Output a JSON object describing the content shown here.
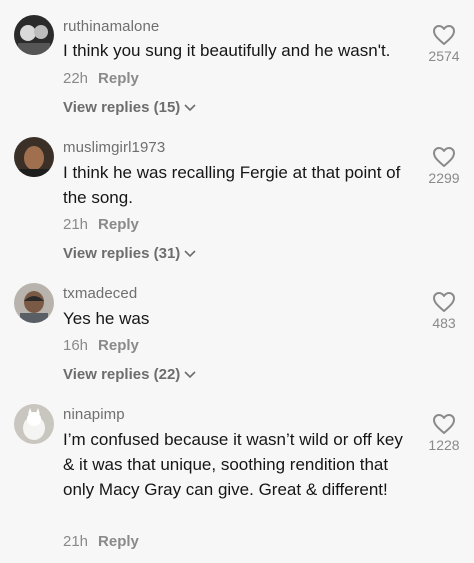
{
  "comments": [
    {
      "username": "ruthinamalone",
      "text": "I think you sung it beautifully and he wasn't.",
      "time": "22h",
      "reply_label": "Reply",
      "view_replies": "View replies (15)",
      "likes": "2574"
    },
    {
      "username": "muslimgirl1973",
      "text": "I think he was recalling Fergie at that point of the song.",
      "time": "21h",
      "reply_label": "Reply",
      "view_replies": "View replies (31)",
      "likes": "2299"
    },
    {
      "username": "txmadeced",
      "text": "Yes he was",
      "time": "16h",
      "reply_label": "Reply",
      "view_replies": "View replies (22)",
      "likes": "483"
    },
    {
      "username": "ninapimp",
      "text": "I’m confused because it wasn’t wild or off key & it was that unique, soothing rendition that only Macy Gray can give. Great & different!",
      "time": "21h",
      "reply_label": "Reply",
      "likes": "1228"
    }
  ]
}
